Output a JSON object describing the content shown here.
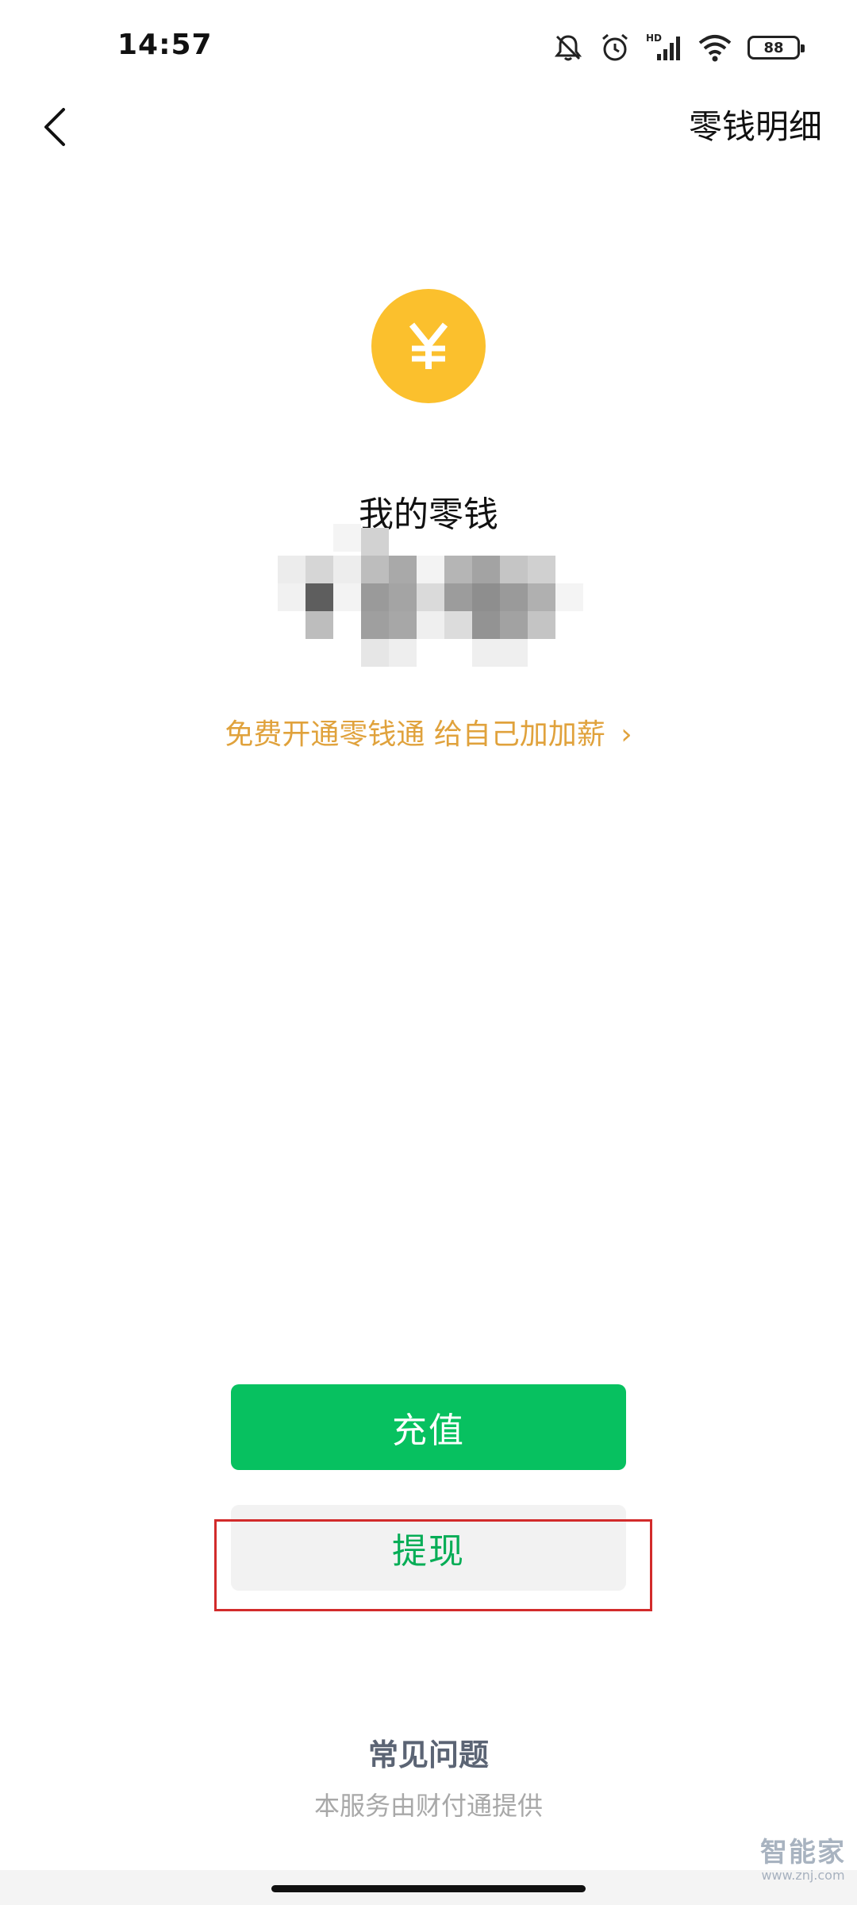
{
  "status_bar": {
    "time": "14:57",
    "battery": "88",
    "icons": [
      "bell-mute-icon",
      "alarm-icon",
      "hd-signal-icon",
      "wifi-icon",
      "battery-icon"
    ]
  },
  "nav": {
    "back_icon": "chevron-left-icon",
    "title_link": "零钱明细"
  },
  "balance": {
    "coin_icon": "yuan-coin-icon",
    "coin_symbol": "¥",
    "label": "我的零钱",
    "amount_obscured": true
  },
  "promo": {
    "text": "免费开通零钱通 给自己加加薪",
    "arrow": "›"
  },
  "actions": {
    "recharge_label": "充值",
    "withdraw_label": "提现"
  },
  "footer": {
    "faq_label": "常见问题",
    "provider_note": "本服务由财付通提供"
  },
  "watermark": {
    "main": "智能家",
    "sub": "www.znj.com"
  },
  "colors": {
    "primary_green": "#07c160",
    "withdraw_text_green": "#06ad56",
    "coin_yellow": "#fbc02d",
    "promo_orange": "#e0a23c",
    "highlight_red": "#d22b2b"
  }
}
